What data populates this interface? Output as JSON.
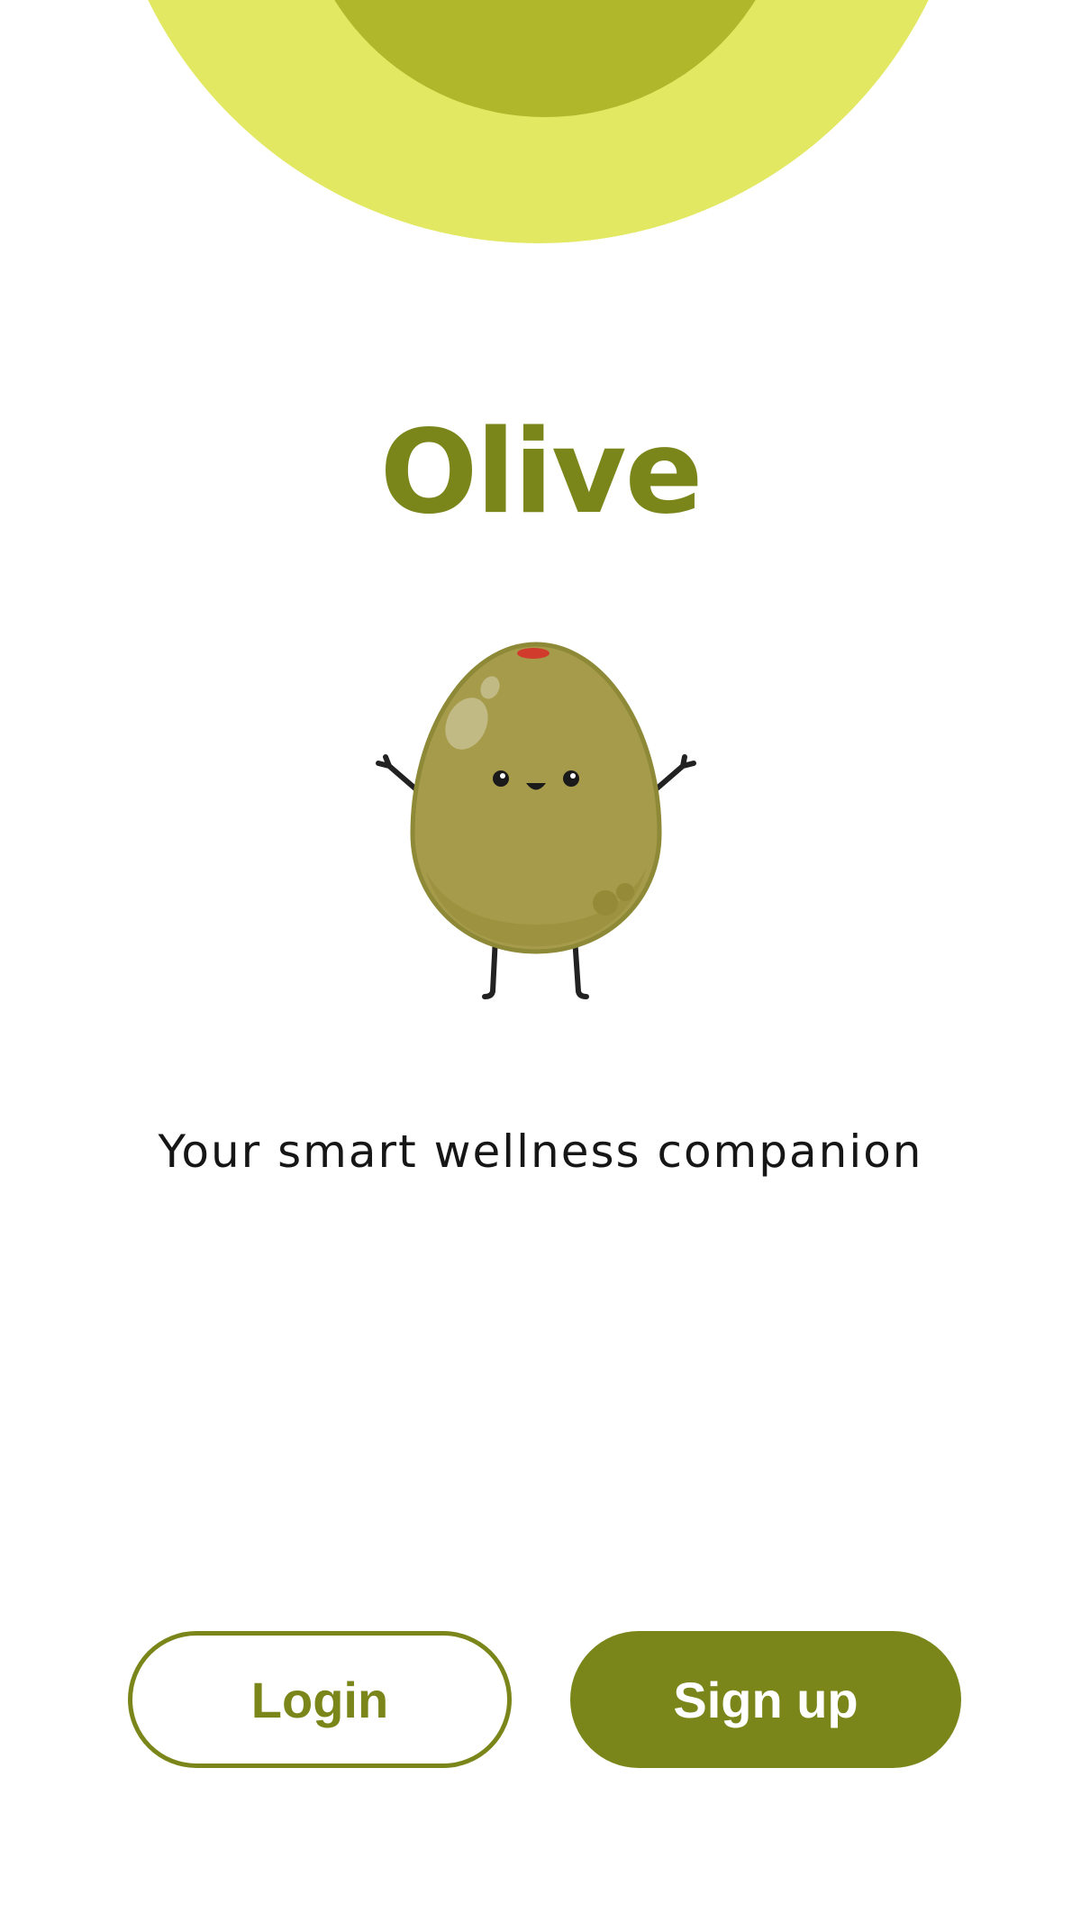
{
  "app": {
    "title": "Olive",
    "tagline": "Your smart wellness companion",
    "mascot_icon": "olive-mascot-icon"
  },
  "actions": {
    "login_label": "Login",
    "signup_label": "Sign up"
  },
  "colors": {
    "brand": "#7b861a",
    "accent_light": "#e3e862",
    "accent_mid": "#b0b72b",
    "mascot_body": "#a59b4a",
    "pimento": "#d13b2b",
    "background": "#ffffff",
    "text": "#161616"
  }
}
